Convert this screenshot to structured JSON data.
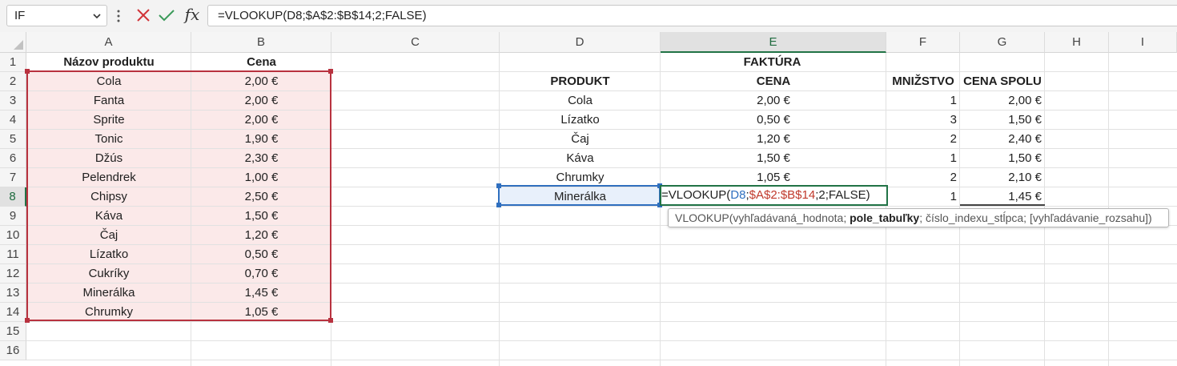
{
  "formula_bar": {
    "name_box": "IF",
    "fx_label": "fx",
    "formula": "=VLOOKUP(D8;$A$2:$B$14;2;FALSE)"
  },
  "columns": [
    "A",
    "B",
    "C",
    "D",
    "E",
    "F",
    "G",
    "H",
    "I"
  ],
  "rows": [
    "1",
    "2",
    "3",
    "4",
    "5",
    "6",
    "7",
    "8",
    "9",
    "10",
    "11",
    "12",
    "13",
    "14",
    "15",
    "16"
  ],
  "price_list": {
    "header_name": "Názov produktu",
    "header_price": "Cena",
    "items": [
      {
        "name": "Cola",
        "price": "2,00 €"
      },
      {
        "name": "Fanta",
        "price": "2,00 €"
      },
      {
        "name": "Sprite",
        "price": "2,00 €"
      },
      {
        "name": "Tonic",
        "price": "1,90 €"
      },
      {
        "name": "Džús",
        "price": "2,30 €"
      },
      {
        "name": "Pelendrek",
        "price": "1,00 €"
      },
      {
        "name": "Chipsy",
        "price": "2,50 €"
      },
      {
        "name": "Káva",
        "price": "1,50 €"
      },
      {
        "name": "Čaj",
        "price": "1,20 €"
      },
      {
        "name": "Lízatko",
        "price": "0,50 €"
      },
      {
        "name": "Cukríky",
        "price": "0,70 €"
      },
      {
        "name": "Minerálka",
        "price": "1,45 €"
      },
      {
        "name": "Chrumky",
        "price": "1,05 €"
      }
    ]
  },
  "invoice": {
    "title": "FAKTÚRA",
    "headers": {
      "product": "PRODUKT",
      "price": "CENA",
      "qty": "MNIŽSTVO",
      "total": "CENA SPOLU"
    },
    "rows": [
      {
        "product": "Cola",
        "price": "2,00 €",
        "qty": "1",
        "total": "2,00 €"
      },
      {
        "product": "Lízatko",
        "price": "0,50 €",
        "qty": "3",
        "total": "1,50 €"
      },
      {
        "product": "Čaj",
        "price": "1,20 €",
        "qty": "2",
        "total": "2,40 €"
      },
      {
        "product": "Káva",
        "price": "1,50 €",
        "qty": "1",
        "total": "1,50 €"
      },
      {
        "product": "Chrumky",
        "price": "1,05 €",
        "qty": "2",
        "total": "2,10 €"
      },
      {
        "product": "Minerálka",
        "price": "",
        "qty": "1",
        "total": "1,45 €"
      }
    ],
    "editing": {
      "prefix": "=VLOOKUP(",
      "ref1": "D8",
      "sep1": ";",
      "ref2": "$A$2:$B$14",
      "suffix": ";2;FALSE)"
    }
  },
  "tooltip": {
    "start": "VLOOKUP(vyhľadávaná_hodnota; ",
    "bold": "pole_tabuľky",
    "end": "; číslo_indexu_stĺpca; [vyhľadávanie_rozsahu])"
  },
  "colors": {
    "accent_green": "#217346",
    "range_red": "#b8323f",
    "ref_blue": "#2f6fbf",
    "range_fill": "#fbe9e9"
  },
  "icons": {
    "cancel": "x-icon",
    "enter": "check-icon",
    "function": "fx-icon",
    "namebox_dropdown": "chevron-down-icon",
    "more": "vertical-dots-icon"
  }
}
